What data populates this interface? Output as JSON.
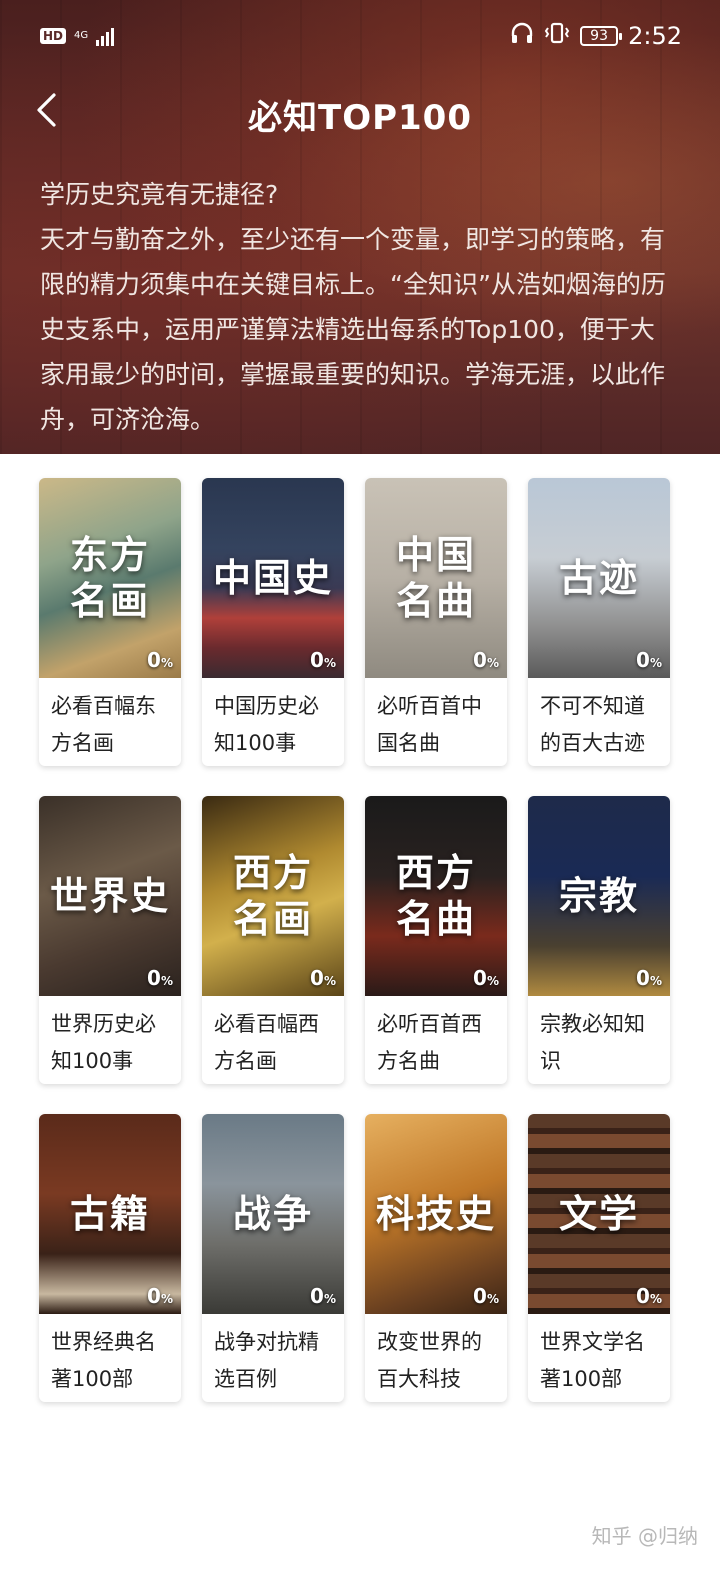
{
  "status_bar": {
    "hd": "HD",
    "network": "4G",
    "battery": "93",
    "time": "2:52"
  },
  "nav": {
    "title": "必知TOP100",
    "back_icon": "chevron-left-icon"
  },
  "intro": {
    "question": "学历史究竟有无捷径?",
    "body": "天才与勤奋之外，至少还有一个变量，即学习的策略，有限的精力须集中在关键目标上。“全知识”从浩如烟海的历史支系中，运用严谨算法精选出每系的Top100，便于大家用最少的时间，掌握最重要的知识。学海无涯，以此作舟，可济沧海。"
  },
  "cards": [
    {
      "cover_title": "东方\n名画",
      "progress": "0",
      "unit": "%",
      "caption": "必看百幅东方名画"
    },
    {
      "cover_title": "中国史",
      "progress": "0",
      "unit": "%",
      "caption": "中国历史必知100事"
    },
    {
      "cover_title": "中国\n名曲",
      "progress": "0",
      "unit": "%",
      "caption": "必听百首中国名曲"
    },
    {
      "cover_title": "古迹",
      "progress": "0",
      "unit": "%",
      "caption": "不可不知道的百大古迹"
    },
    {
      "cover_title": "世界史",
      "progress": "0",
      "unit": "%",
      "caption": "世界历史必知100事"
    },
    {
      "cover_title": "西方\n名画",
      "progress": "0",
      "unit": "%",
      "caption": "必看百幅西方名画"
    },
    {
      "cover_title": "西方\n名曲",
      "progress": "0",
      "unit": "%",
      "caption": "必听百首西方名曲"
    },
    {
      "cover_title": "宗教",
      "progress": "0",
      "unit": "%",
      "caption": "宗教必知知识"
    },
    {
      "cover_title": "古籍",
      "progress": "0",
      "unit": "%",
      "caption": "世界经典名著100部"
    },
    {
      "cover_title": "战争",
      "progress": "0",
      "unit": "%",
      "caption": "战争对抗精选百例"
    },
    {
      "cover_title": "科技史",
      "progress": "0",
      "unit": "%",
      "caption": "改变世界的百大科技"
    },
    {
      "cover_title": "文学",
      "progress": "0",
      "unit": "%",
      "caption": "世界文学名著100部"
    }
  ],
  "watermark": "知乎 @归纳"
}
